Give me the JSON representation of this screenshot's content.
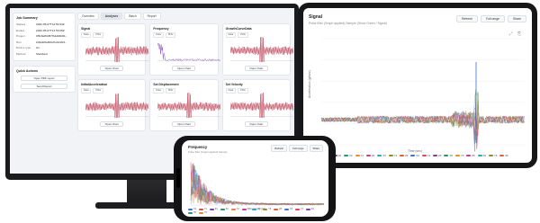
{
  "monitor": {
    "sidebar": {
      "job_summary": {
        "title": "Job Summary",
        "rows": [
          {
            "k": "Started",
            "v": "2022-05-07T14:52:03Z"
          },
          {
            "k": "Ended",
            "v": "2022-05-07T14:53:05Z"
          },
          {
            "k": "Project",
            "v": "9f5c8e83d57fb4d94b84..."
          },
          {
            "k": "Run",
            "v": "2c8a1f0a3b6d7e9c4f21..."
          },
          {
            "k": "Device type",
            "v": "A1"
          },
          {
            "k": "Method",
            "v": "Standard"
          }
        ]
      },
      "quick_actions": {
        "title": "Quick Actions",
        "buttons": [
          "Open PDF report",
          "Send Report"
        ]
      }
    },
    "tabs": [
      "Overview",
      "Analyses",
      "Batch",
      "Report"
    ],
    "active_tab": "Analyses",
    "cells": [
      {
        "title": "Signal",
        "btns": [
          "Data",
          "PNG"
        ],
        "open": "Open chart"
      },
      {
        "title": "Frequency",
        "btns": [
          "Data",
          "PNG"
        ],
        "open": "Open chart"
      },
      {
        "title": "GrowthCurveData",
        "btns": [
          "Data",
          "PNG"
        ],
        "open": "Open chart"
      },
      {
        "title": "InitialAcceleration",
        "btns": [
          "Data",
          "PNG"
        ],
        "open": "Open chart"
      },
      {
        "title": "Set Displacement",
        "btns": [
          "Data",
          "PNG"
        ],
        "open": "Open chart"
      },
      {
        "title": "Set Velocity",
        "btns": [
          "Data",
          "PNG"
        ],
        "open": "Open chart"
      }
    ]
  },
  "tablet": {
    "title": "Signal",
    "subtitle": "Pulse filter (Graph applied) Sample (Show Green / Signal)",
    "buttons": [
      "Refresh",
      "Full range",
      "Share"
    ],
    "tools": "⤢ ⎘",
    "xlabel": "Time (sec)",
    "ylabel": "Acceleration (g/m/s²)",
    "legend": [
      "X1",
      "Y1",
      "Z1",
      "X2",
      "Y2",
      "Z2",
      "X3",
      "Y3",
      "Z3",
      "X4",
      "Y4",
      "Z4",
      "X5",
      "Y5",
      "Z5",
      "X6",
      "Y6",
      "Z6"
    ]
  },
  "phone": {
    "title": "Frequency",
    "subtitle": "Pulse filter (Graph applied) Sample",
    "buttons": [
      "Refresh",
      "Full range",
      "Share"
    ],
    "xlabel": "Frequency (Hz)",
    "legend": [
      "X1",
      "Y1",
      "Z1",
      "X2",
      "Y2",
      "Z2",
      "X3",
      "Y3",
      "Z3",
      "X4",
      "Y4",
      "Z4",
      "X5",
      "Y5"
    ]
  },
  "colors": {
    "series": [
      "#3b6fd8",
      "#e0465a",
      "#7a3fb8",
      "#1f9a6e",
      "#e68a2e",
      "#c43c8e",
      "#2aa7c9",
      "#8a8f2c",
      "#d95f3b"
    ],
    "accent": "#2f6bd6"
  }
}
